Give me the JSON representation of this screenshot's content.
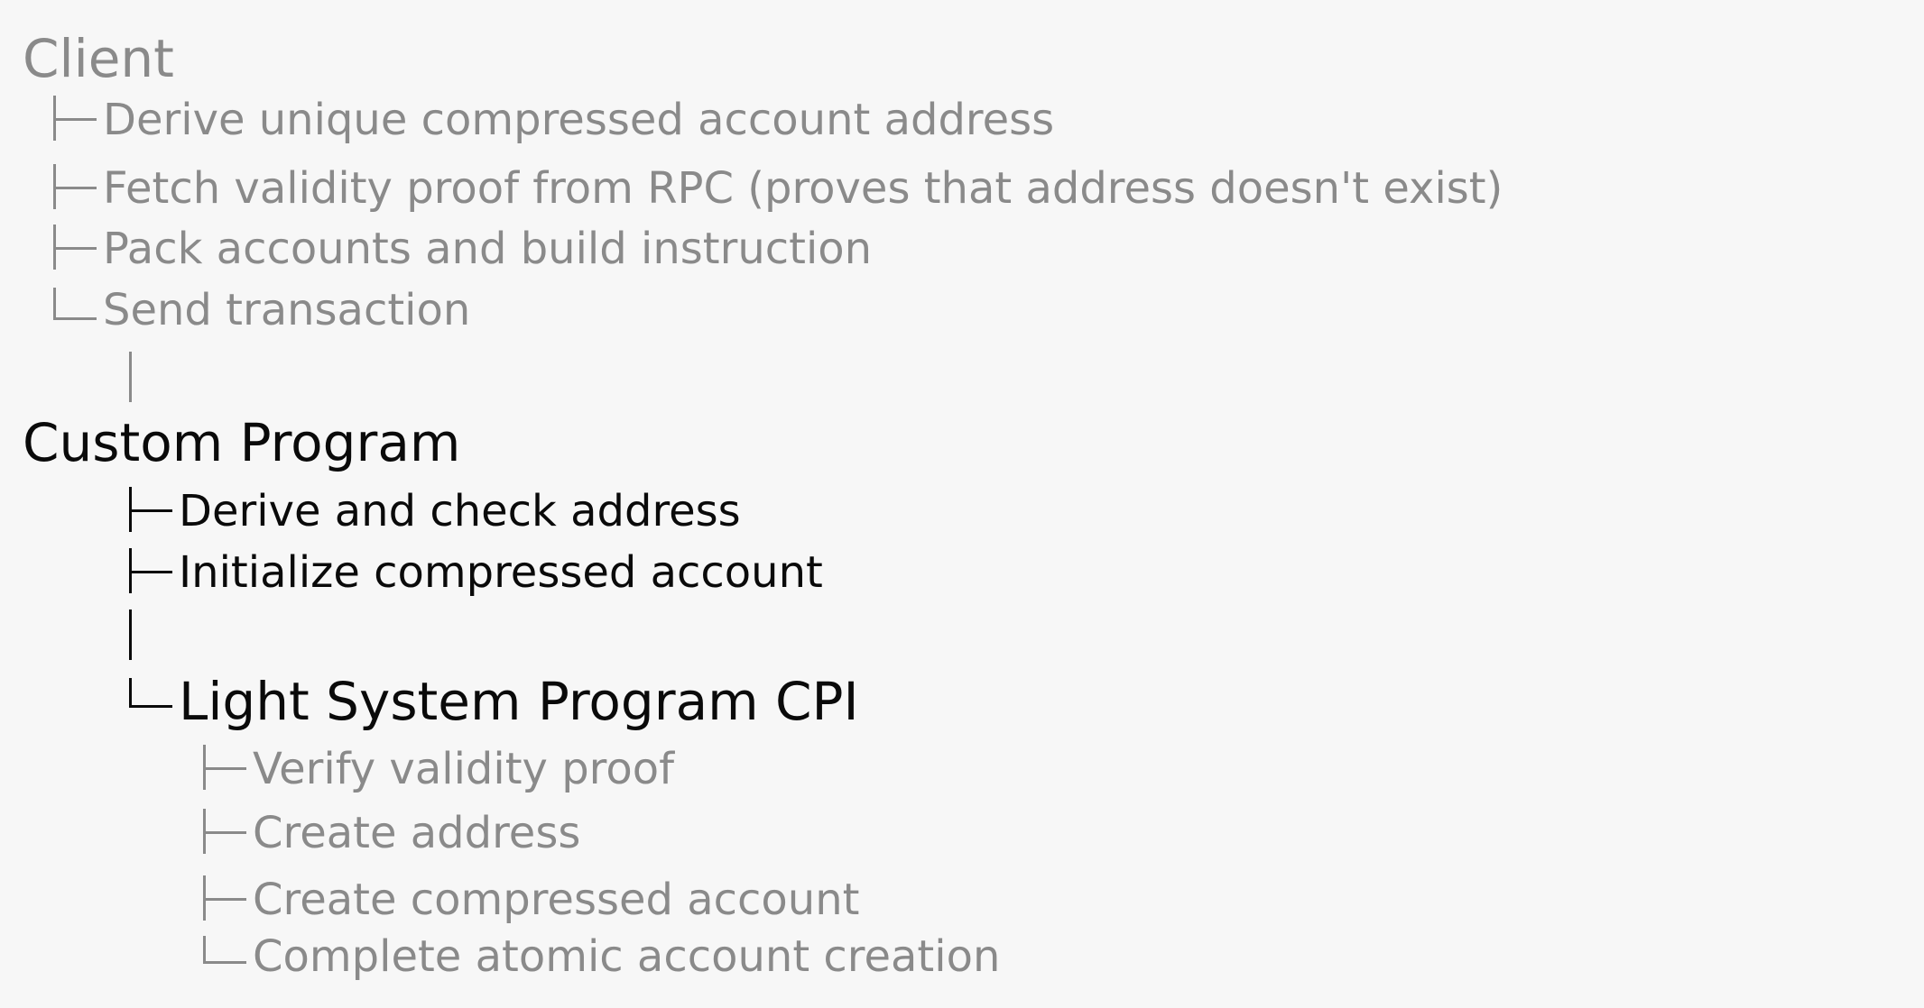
{
  "client": {
    "title": "Client",
    "steps": [
      "Derive unique compressed account address",
      "Fetch validity proof from RPC (proves that address doesn't exist)",
      "Pack accounts and build instruction",
      "Send transaction"
    ]
  },
  "custom_program": {
    "title": "Custom Program",
    "steps": [
      "Derive and check address",
      "Initialize compressed account"
    ]
  },
  "light_system_program": {
    "title": "Light System Program CPI",
    "steps": [
      "Verify validity proof",
      "Create address",
      "Create compressed account",
      "Complete atomic account creation"
    ]
  },
  "colors": {
    "background": "#f7f7f7",
    "muted_text": "#8a8a8a",
    "dark_text": "#0a0a0a"
  }
}
